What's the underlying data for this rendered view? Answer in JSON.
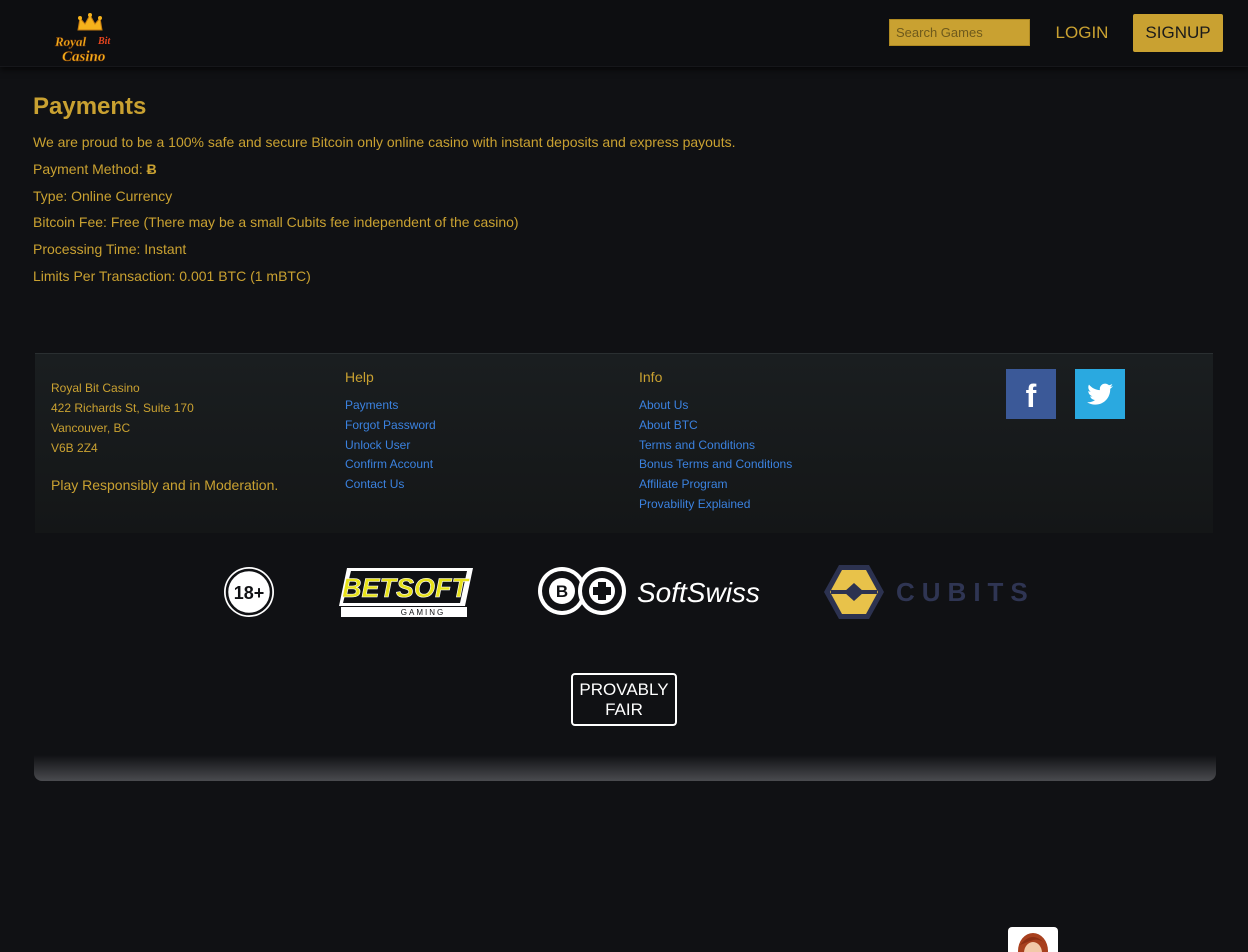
{
  "brand": {
    "logo_line1": "Royal",
    "logo_line2": "Bit",
    "logo_line3": "Casino"
  },
  "header": {
    "search_placeholder": "Search Games",
    "login_label": "LOGIN",
    "signup_label": "SIGNUP"
  },
  "main": {
    "title": "Payments",
    "intro": "We are proud to be a 100% safe and secure Bitcoin only online casino with instant deposits and express payouts.",
    "payment_method_label": "Payment Method:",
    "payment_method_glyph": "Ƀ",
    "type": "Type: Online Currency",
    "fee": "Bitcoin Fee: Free (There may be a small Cubits fee independent of the casino)",
    "processing": "Processing Time: Instant",
    "limits": "Limits Per Transaction: 0.001 BTC (1 mBTC)"
  },
  "footer": {
    "address": [
      "Royal Bit Casino",
      "422 Richards St, Suite 170",
      "Vancouver, BC",
      "V6B 2Z4"
    ],
    "moderation": "Play Responsibly and in Moderation.",
    "help_heading": "Help",
    "help_links": [
      "Payments",
      "Forgot Password",
      "Unlock User",
      "Confirm Account",
      "Contact Us"
    ],
    "info_heading": "Info",
    "info_links": [
      "About Us",
      "About BTC",
      "Terms and Conditions",
      "Bonus Terms and Conditions",
      "Affiliate Program",
      "Provability Explained"
    ],
    "social": {
      "facebook_glyph": "f"
    }
  },
  "partners": {
    "age": "18+",
    "betsoft_main": "BETSOFT",
    "betsoft_sub": "GAMING",
    "softswiss": "SoftSwiss",
    "cubits": "CUBITS",
    "provably_line1": "PROVABLY",
    "provably_line2": "FAIR"
  },
  "colors": {
    "accent": "#c9a131",
    "link": "#3b82e0",
    "background": "#101114"
  }
}
